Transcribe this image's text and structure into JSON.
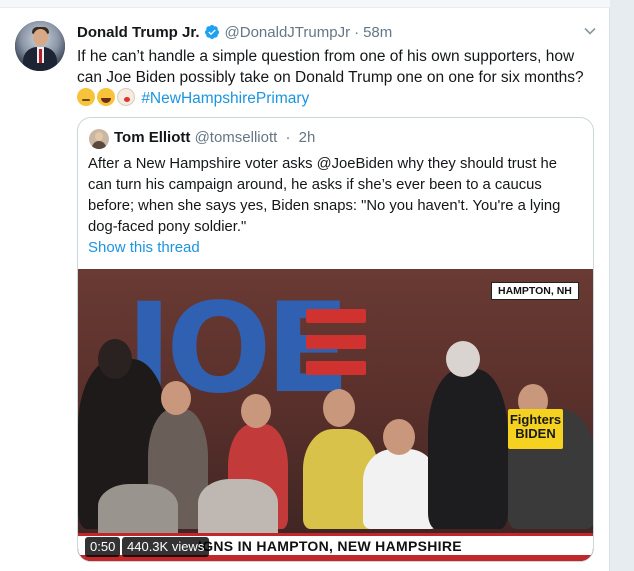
{
  "tweet": {
    "author_name": "Donald Trump Jr.",
    "author_handle": "@DonaldJTrumpJr",
    "separator": "·",
    "time": "58m",
    "text": "If he can’t handle a simple question from one of his own supporters, how can Joe Biden possibly take on Donald Trump one on one for six months?",
    "hashtag": "#NewHampshirePrimary",
    "emojis": [
      "thinking-face",
      "rolling-laughing-face",
      "clown-face"
    ]
  },
  "quoted": {
    "author_name": "Tom Elliott",
    "author_handle": "@tomselliott",
    "separator": "·",
    "time": "2h",
    "text": "After a New Hampshire voter asks @JoeBiden why they should trust he can turn his campaign around, he asks if she’s ever been to a caucus before; when she says yes, Biden snaps: \"No you haven't. You're a lying dog-faced pony soldier.\"",
    "show_thread": "Show this thread",
    "video": {
      "location_tag": "HAMPTON, NH",
      "lower_third": "IGNS IN HAMPTON, NEW HAMPSHIRE",
      "stage_logo": "JOE",
      "sign_text": "Fighters BIDEN",
      "elapsed": "0:50",
      "views": "440.3K views"
    }
  },
  "colors": {
    "link": "#1b95e0",
    "muted": "#657786",
    "verified": "#1da1f2",
    "border": "#ccd6dd"
  }
}
